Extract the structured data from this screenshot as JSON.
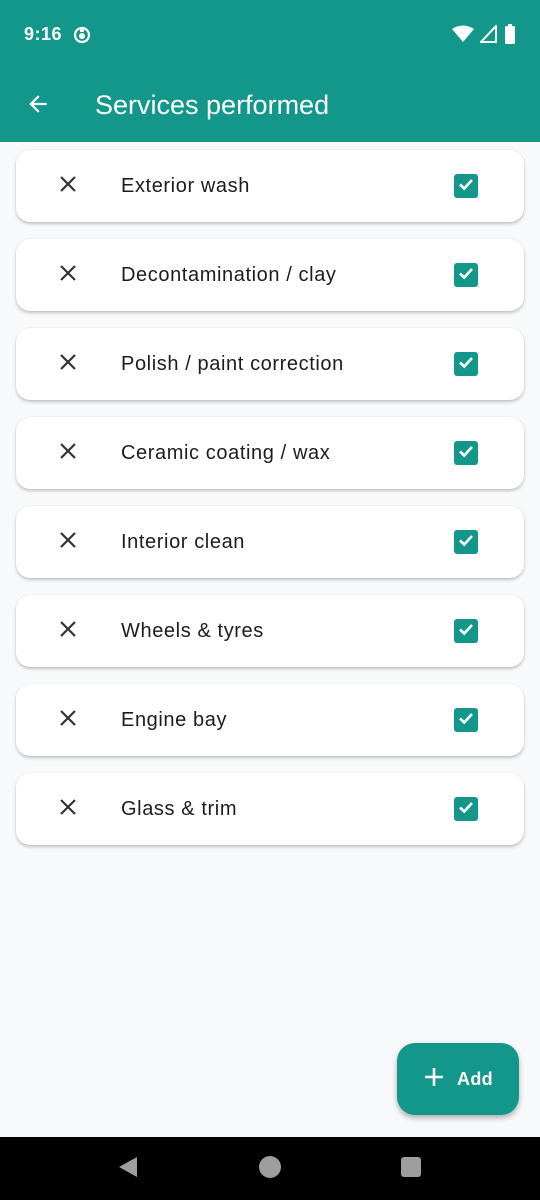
{
  "status_bar": {
    "time": "9:16",
    "icons": [
      "app-notification-icon",
      "wifi-icon",
      "cell-signal-icon",
      "battery-icon"
    ]
  },
  "app_bar": {
    "title": "Services performed",
    "back_icon": "arrow-back-icon"
  },
  "services": [
    {
      "label": "Exterior wash",
      "checked": true
    },
    {
      "label": "Decontamination / clay",
      "checked": true
    },
    {
      "label": "Polish / paint correction",
      "checked": true
    },
    {
      "label": "Ceramic coating / wax",
      "checked": true
    },
    {
      "label": "Interior clean",
      "checked": true
    },
    {
      "label": "Wheels & tyres",
      "checked": true
    },
    {
      "label": "Engine bay",
      "checked": true
    },
    {
      "label": "Glass & trim",
      "checked": true
    }
  ],
  "fab": {
    "label": "Add",
    "icon": "plus-icon"
  },
  "nav": {
    "icons": [
      "nav-back-icon",
      "nav-home-icon",
      "nav-recents-icon"
    ]
  },
  "colors": {
    "primary": "#14978B",
    "background": "#F7F9FB",
    "card": "#FFFFFF",
    "text": "#1C1C1C"
  }
}
